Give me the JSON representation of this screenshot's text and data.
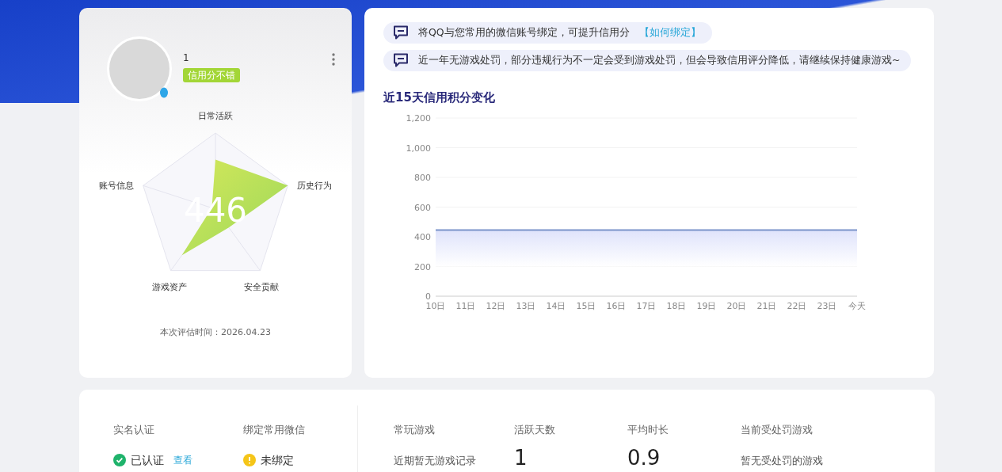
{
  "profile": {
    "name": "1",
    "badge": "信用分不错",
    "score": "446",
    "eval_time": "本次评估时间：2026.04.23"
  },
  "radar": [
    {
      "label": "日常活跃"
    },
    {
      "label": "历史行为"
    },
    {
      "label": "安全贡献"
    },
    {
      "label": "游戏资产"
    },
    {
      "label": "账号信息"
    }
  ],
  "notices": [
    {
      "text": "将QQ与您常用的微信账号绑定，可提升信用分",
      "link": "【如何绑定】"
    },
    {
      "text": "近一年无游戏处罚，部分违规行为不一定会受到游戏处罚，但会导致信用评分降低，请继续保持健康游戏~"
    }
  ],
  "chart_title": "近15天信用积分变化",
  "chart_data": {
    "type": "area",
    "categories": [
      "10日",
      "11日",
      "12日",
      "13日",
      "14日",
      "15日",
      "16日",
      "17日",
      "18日",
      "19日",
      "20日",
      "21日",
      "22日",
      "23日",
      "今天"
    ],
    "grid": true,
    "series": [
      {
        "color": "#7b93c9",
        "values": [
          446,
          446,
          446,
          446,
          446,
          446,
          446,
          446,
          446,
          446,
          446,
          446,
          446,
          446,
          446
        ]
      }
    ],
    "ylim": [
      0,
      1200
    ],
    "yticks": [
      {
        "value": 0,
        "label": "0"
      },
      {
        "value": 200,
        "label": "200"
      },
      {
        "value": 400,
        "label": "400"
      },
      {
        "value": 600,
        "label": "600"
      },
      {
        "value": 800,
        "label": "800"
      },
      {
        "value": 1000,
        "label": "1,000"
      },
      {
        "value": 1200,
        "label": "1,200"
      }
    ]
  },
  "account": [
    {
      "label": "实名认证",
      "kind": "ok",
      "value": "已认证",
      "link": "查看"
    },
    {
      "label": "绑定常用微信",
      "kind": "warn",
      "value": "未绑定"
    }
  ],
  "stats": [
    {
      "label": "常玩游戏",
      "value": "近期暂无游戏记录",
      "kind": "text"
    },
    {
      "label": "活跃天数",
      "value": "1",
      "kind": "big"
    },
    {
      "label": "平均时长",
      "value": "0.9",
      "kind": "big"
    },
    {
      "label": "当前受处罚游戏",
      "value": "暂无受处罚的游戏",
      "kind": "text"
    }
  ]
}
